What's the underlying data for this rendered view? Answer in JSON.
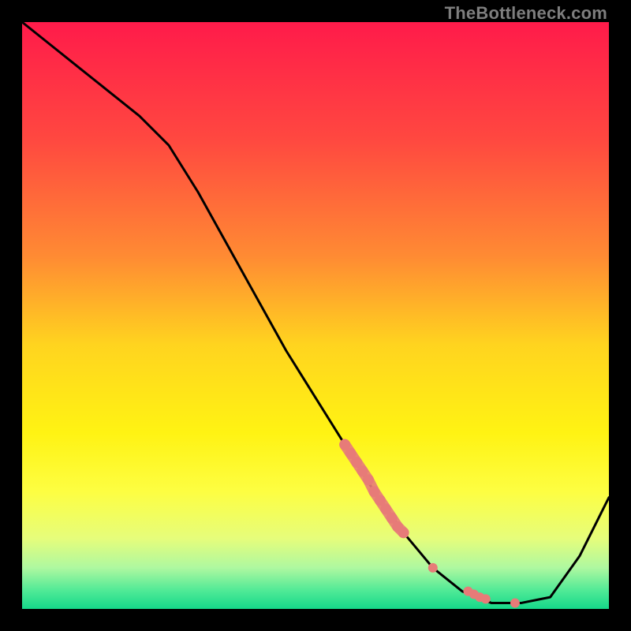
{
  "watermark": "TheBottleneck.com",
  "colors": {
    "curve": "#000000",
    "marker": "#e77b78",
    "frame": "#000000"
  },
  "chart_data": {
    "type": "line",
    "title": "",
    "xlabel": "",
    "ylabel": "",
    "xlim": [
      0,
      100
    ],
    "ylim": [
      0,
      100
    ],
    "grid": false,
    "legend": false,
    "gradient_stops": [
      {
        "pos": 0.0,
        "color": "#ff1b4a"
      },
      {
        "pos": 0.2,
        "color": "#ff4840"
      },
      {
        "pos": 0.4,
        "color": "#ff8b33"
      },
      {
        "pos": 0.55,
        "color": "#ffd41f"
      },
      {
        "pos": 0.7,
        "color": "#fff313"
      },
      {
        "pos": 0.8,
        "color": "#fdfe42"
      },
      {
        "pos": 0.88,
        "color": "#e6fd7b"
      },
      {
        "pos": 0.93,
        "color": "#aef8a0"
      },
      {
        "pos": 0.97,
        "color": "#4de996"
      },
      {
        "pos": 1.0,
        "color": "#15d889"
      }
    ],
    "series": [
      {
        "name": "curve",
        "x": [
          0,
          5,
          10,
          15,
          20,
          25,
          30,
          35,
          40,
          45,
          50,
          55,
          60,
          65,
          70,
          75,
          80,
          85,
          90,
          95,
          100
        ],
        "y": [
          100,
          96,
          92,
          88,
          84,
          79,
          71,
          62,
          53,
          44,
          36,
          28,
          20,
          13,
          7,
          3,
          1,
          1,
          2,
          9,
          19
        ]
      }
    ],
    "markers": [
      {
        "name": "dense-segment",
        "style": "thick-dots",
        "x": [
          55,
          56,
          57,
          58,
          59,
          60,
          61,
          62,
          63,
          64,
          65
        ],
        "y": [
          28,
          26.5,
          25,
          23.5,
          22,
          20,
          18.5,
          17,
          15.5,
          14,
          13
        ]
      },
      {
        "name": "sparse-points",
        "style": "dots",
        "x": [
          70,
          76,
          77,
          78,
          79,
          84
        ],
        "y": [
          7,
          3,
          2.5,
          2,
          1.7,
          1
        ]
      }
    ]
  }
}
